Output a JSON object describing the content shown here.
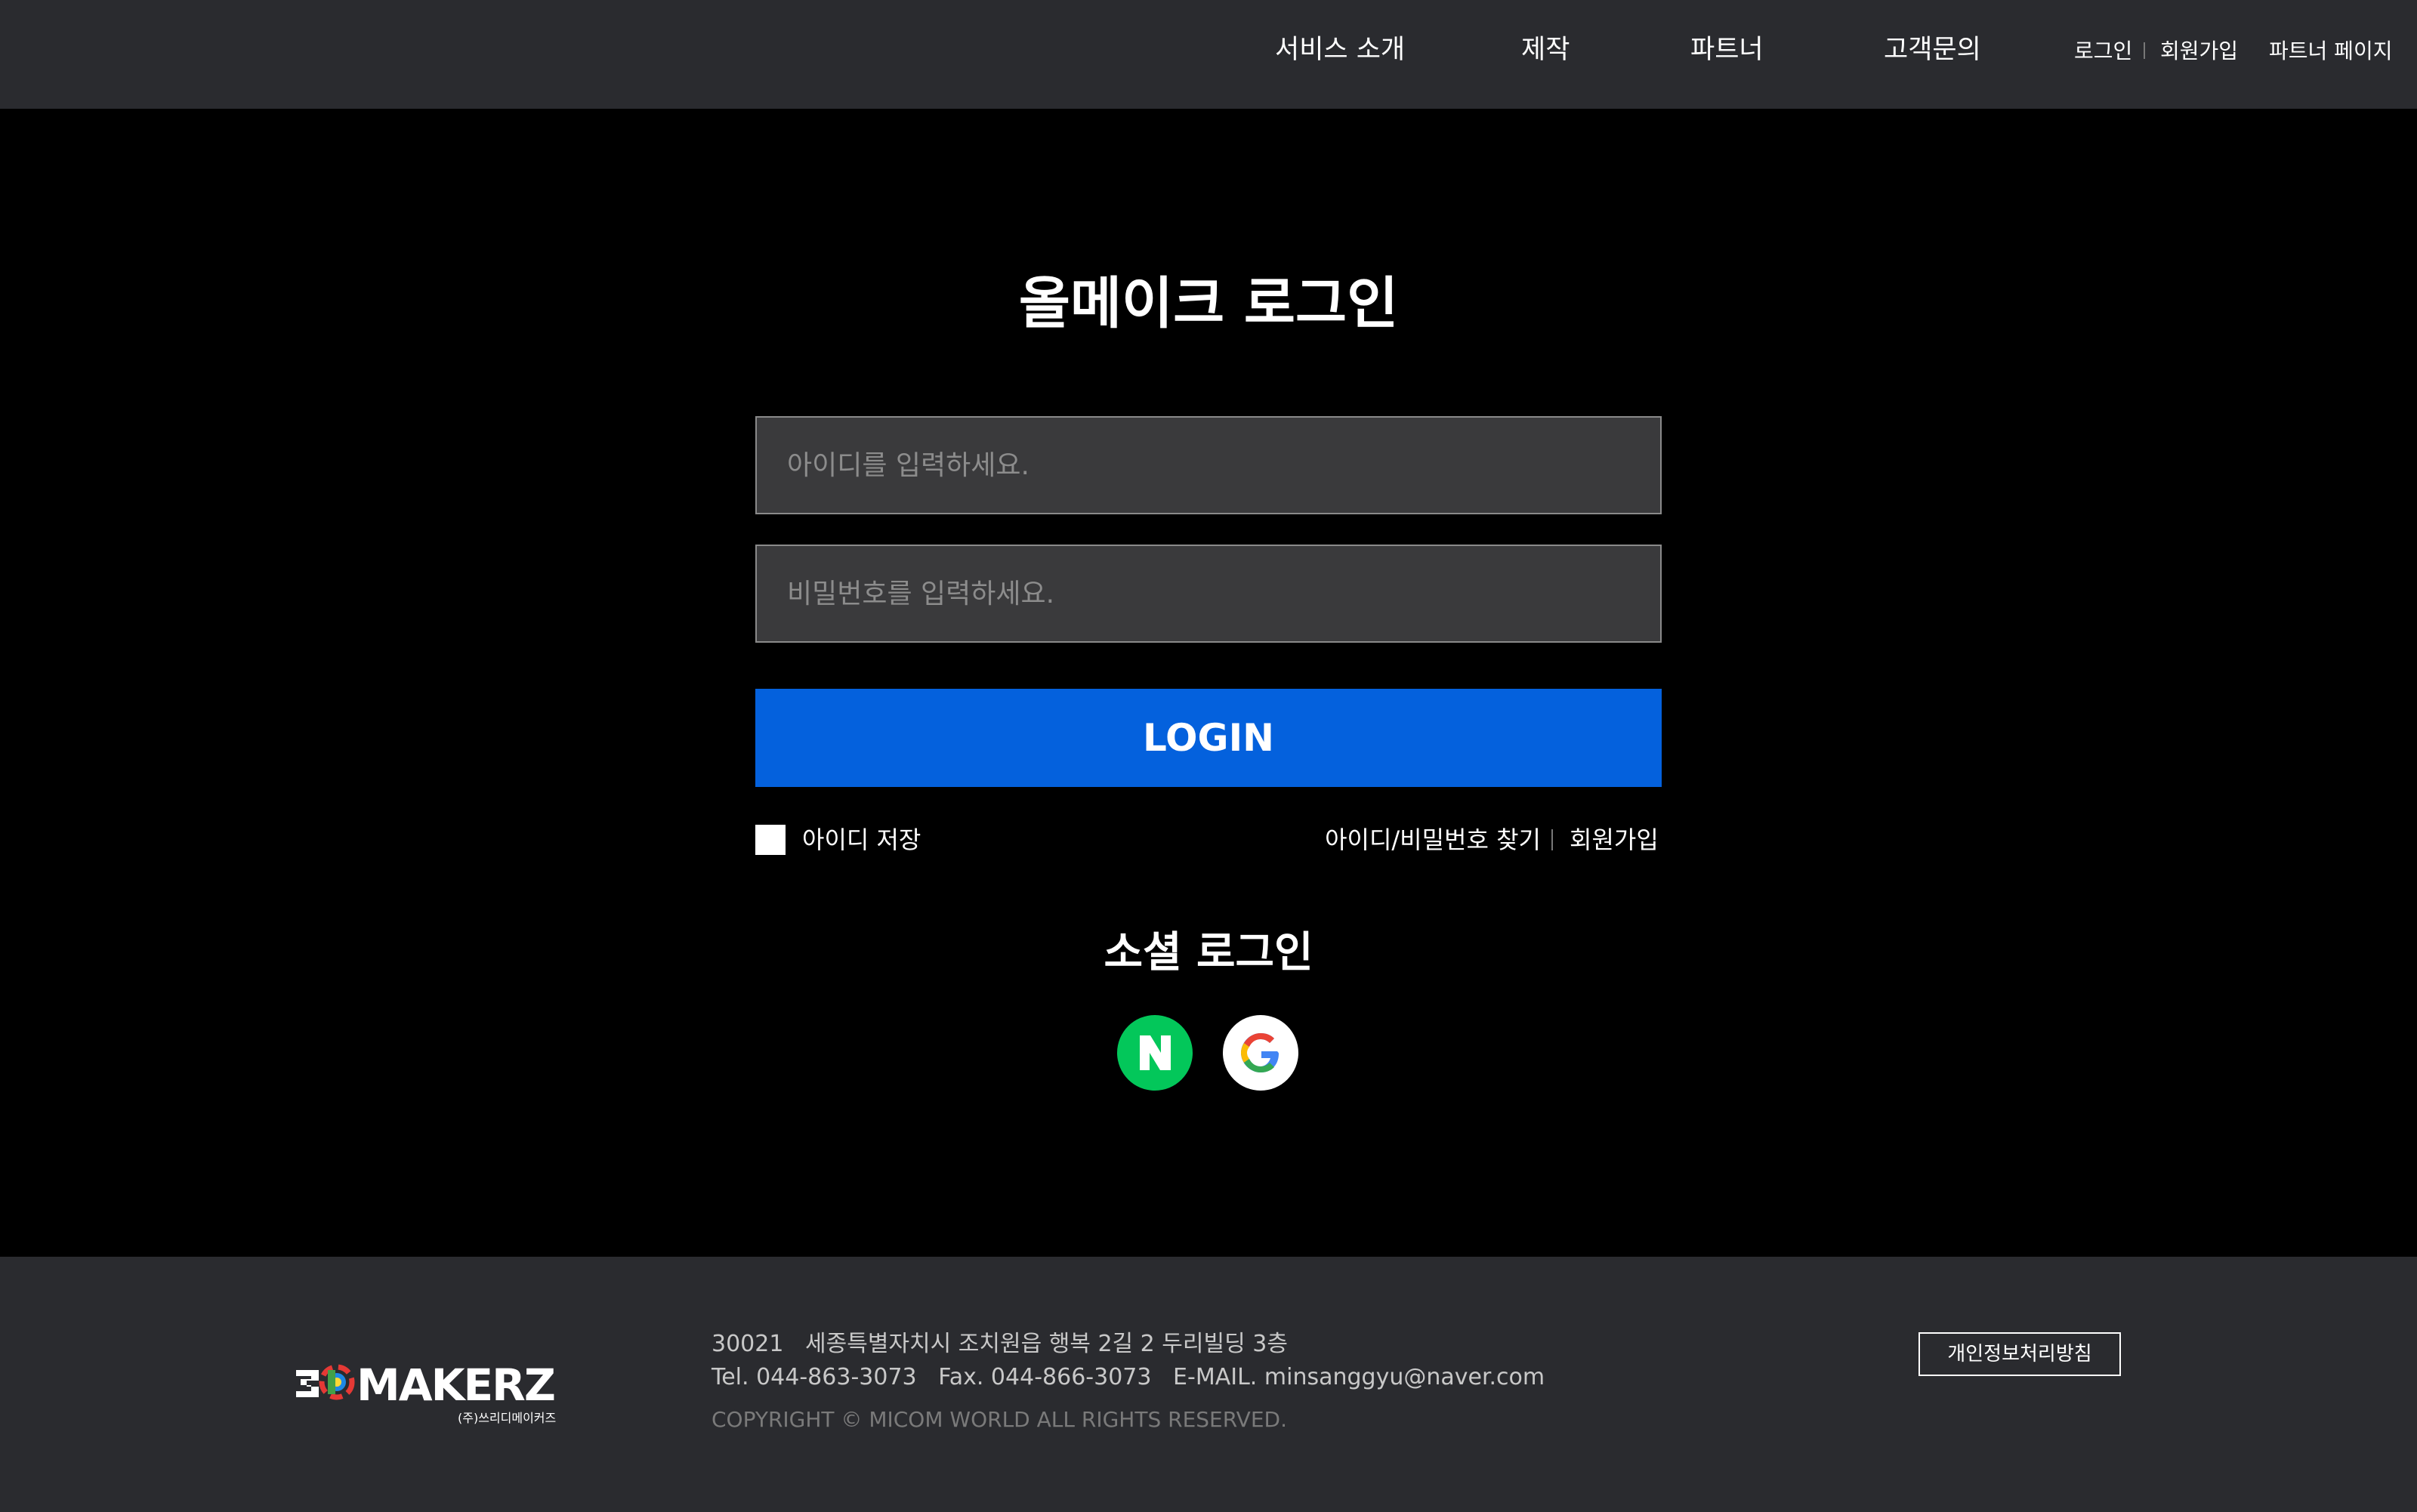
{
  "header": {
    "nav": [
      "서비스 소개",
      "제작",
      "파트너",
      "고객문의"
    ],
    "util": {
      "login": "로그인",
      "signup": "회원가입",
      "partner_page": "파트너 페이지"
    }
  },
  "login": {
    "title": "올메이크 로그인",
    "id_placeholder": "아이디를 입력하세요.",
    "pw_placeholder": "비밀번호를 입력하세요.",
    "button": "LOGIN",
    "save_id": "아이디 저장",
    "find": "아이디/비밀번호 찾기",
    "signup": "회원가입"
  },
  "social": {
    "title": "소셜 로그인",
    "naver_letter": "N",
    "naver_color": "#03c75a"
  },
  "footer": {
    "logo_text": "MAKERZ",
    "logo_sub": "(주)쓰리디메이커즈",
    "address": "30021   세종특별자치시 조치원읍 행복 2길 2 두리빌딩 3층",
    "contact": "Tel. 044-863-3073   Fax. 044-866-3073   E-MAIL. minsanggyu@naver.com",
    "copyright": "COPYRIGHT © MICOM WORLD ALL RIGHTS RESERVED.",
    "privacy": "개인정보처리방침"
  },
  "colors": {
    "header_bg": "#2a2b2f",
    "main_bg": "#000000",
    "login_button": "#0461dd",
    "input_bg": "#3a3a3c"
  }
}
